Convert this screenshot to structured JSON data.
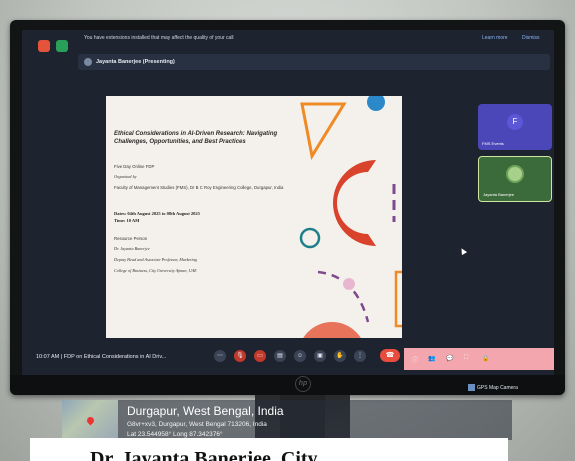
{
  "meeting": {
    "extension_notice": "You have extensions installed that may affect the quality of your call",
    "extension_actions": [
      "Learn more",
      "Dismiss"
    ],
    "presenting_label": "Jayanta Banerjee (Presenting)",
    "time": "10:07 AM",
    "meeting_title": "FDP on Ethical Considerations in AI Driv...",
    "participants": [
      {
        "initial": "F",
        "name": "FMS Events"
      },
      {
        "initial": "",
        "name": "Jayanta Banerjee"
      }
    ]
  },
  "slide": {
    "title": "Ethical Considerations in AI-Driven Research: Navigating Challenges, Opportunities, and Best Practices",
    "subtitle": "Five Day Online FDP",
    "organized_by_label": "Organized by",
    "organizer": "Faculty of Management Studies (FMS), Dr B C Roy Engineering College, Durgapur, India",
    "dates": "Dates: 04th August 2025 to 08th August 2025",
    "times": "Time: 10 AM",
    "resource_person_label": "Resource Person",
    "resource_name": "Dr. Jayanta Banerjee",
    "resource_role": "Deputy Head and Associate Professor, Marketing",
    "resource_org": "College of Business, City University Ajman, UAE",
    "accent_colors": {
      "orange": "#f08a24",
      "red": "#d9432b",
      "teal": "#1e7f8a",
      "purple": "#7d4a8e",
      "pink": "#e9b6cf",
      "blue": "#2b89c9",
      "salmon": "#e8735b"
    }
  },
  "monitor": {
    "brand": "hp",
    "camera_label": "GPS Map Camera"
  },
  "location": {
    "city": "Durgapur, West Bengal, India",
    "address": "G8vr+xv3, Durgapur, West Bengal 713206, India",
    "latlon": "Lat 23.544958° Long 87.342376°"
  },
  "caption": {
    "text": "Dr. Jayanta Banerjee, City"
  }
}
